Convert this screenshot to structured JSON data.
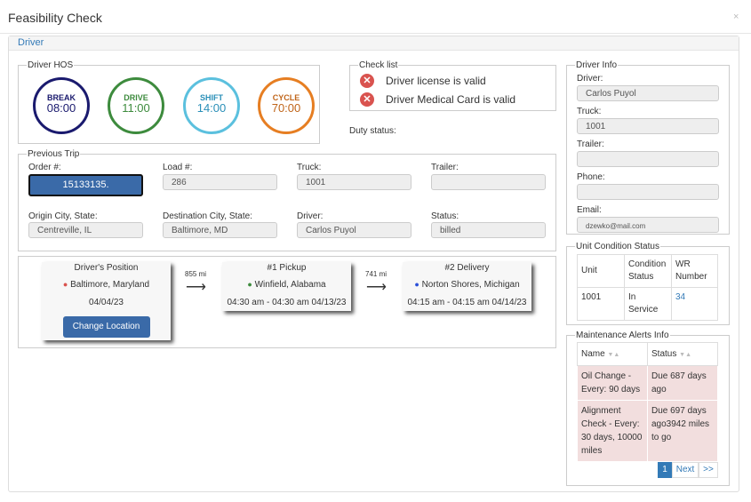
{
  "modal": {
    "title": "Feasibility Check",
    "close": "×"
  },
  "panel": {
    "tab_label": "Driver"
  },
  "hos": {
    "legend": "Driver HOS",
    "items": [
      {
        "label": "BREAK",
        "value": "08:00",
        "color": "#1a1a6e"
      },
      {
        "label": "DRIVE",
        "value": "11:00",
        "color": "#3d8b3d"
      },
      {
        "label": "SHIFT",
        "value": "14:00",
        "color": "#5bc0de"
      },
      {
        "label": "CYCLE",
        "value": "70:00",
        "color": "#e67e22"
      }
    ]
  },
  "checklist": {
    "legend": "Check list",
    "items": [
      "Driver license is valid",
      "Driver Medical Card is valid"
    ],
    "duty_status_label": "Duty status:"
  },
  "previous_trip": {
    "legend": "Previous Trip",
    "order_label": "Order #:",
    "order_value": "15133135.",
    "load_label": "Load #:",
    "load_value": "286",
    "truck_label": "Truck:",
    "truck_value": "1001",
    "trailer_label": "Trailer:",
    "trailer_value": "",
    "origin_label": "Origin City, State:",
    "origin_value": "Centreville, IL",
    "destination_label": "Destination City, State:",
    "destination_value": "Baltimore, MD",
    "driver_label": "Driver:",
    "driver_value": "Carlos Puyol",
    "status_label": "Status:",
    "status_value": "billed"
  },
  "route": {
    "position": {
      "title": "Driver's Position",
      "location": "Baltimore, Maryland",
      "date": "04/04/23",
      "button": "Change Location"
    },
    "leg1_distance": "855 mi",
    "pickup": {
      "title": "#1 Pickup",
      "location": "Winfield, Alabama",
      "time": "04:30 am - 04:30 am 04/13/23"
    },
    "leg2_distance": "741 mi",
    "delivery": {
      "title": "#2 Delivery",
      "location": "Norton Shores, Michigan",
      "time": "04:15 am - 04:15 am 04/14/23"
    }
  },
  "driver_info": {
    "legend": "Driver Info",
    "driver_label": "Driver:",
    "driver_value": "Carlos Puyol",
    "truck_label": "Truck:",
    "truck_value": "1001",
    "trailer_label": "Trailer:",
    "trailer_value": "",
    "phone_label": "Phone:",
    "phone_value": "",
    "email_label": "Email:",
    "email_value": "dzewko@mail.com"
  },
  "unit_condition": {
    "legend": "Unit Condition Status",
    "headers": [
      "Unit",
      "Condition Status",
      "WR Number"
    ],
    "row": [
      "1001",
      "In Service",
      "34"
    ]
  },
  "maintenance": {
    "legend": "Maintenance Alerts Info",
    "headers": [
      "Name",
      "Status"
    ],
    "rows": [
      [
        "Oil Change - Every: 90 days",
        "Due 687 days ago"
      ],
      [
        "Alignment Check - Every: 30 days, 10000 miles",
        "Due 697 days ago3942 miles to go"
      ]
    ],
    "pager": {
      "current": "1",
      "next": "Next",
      "last": ">>"
    }
  }
}
